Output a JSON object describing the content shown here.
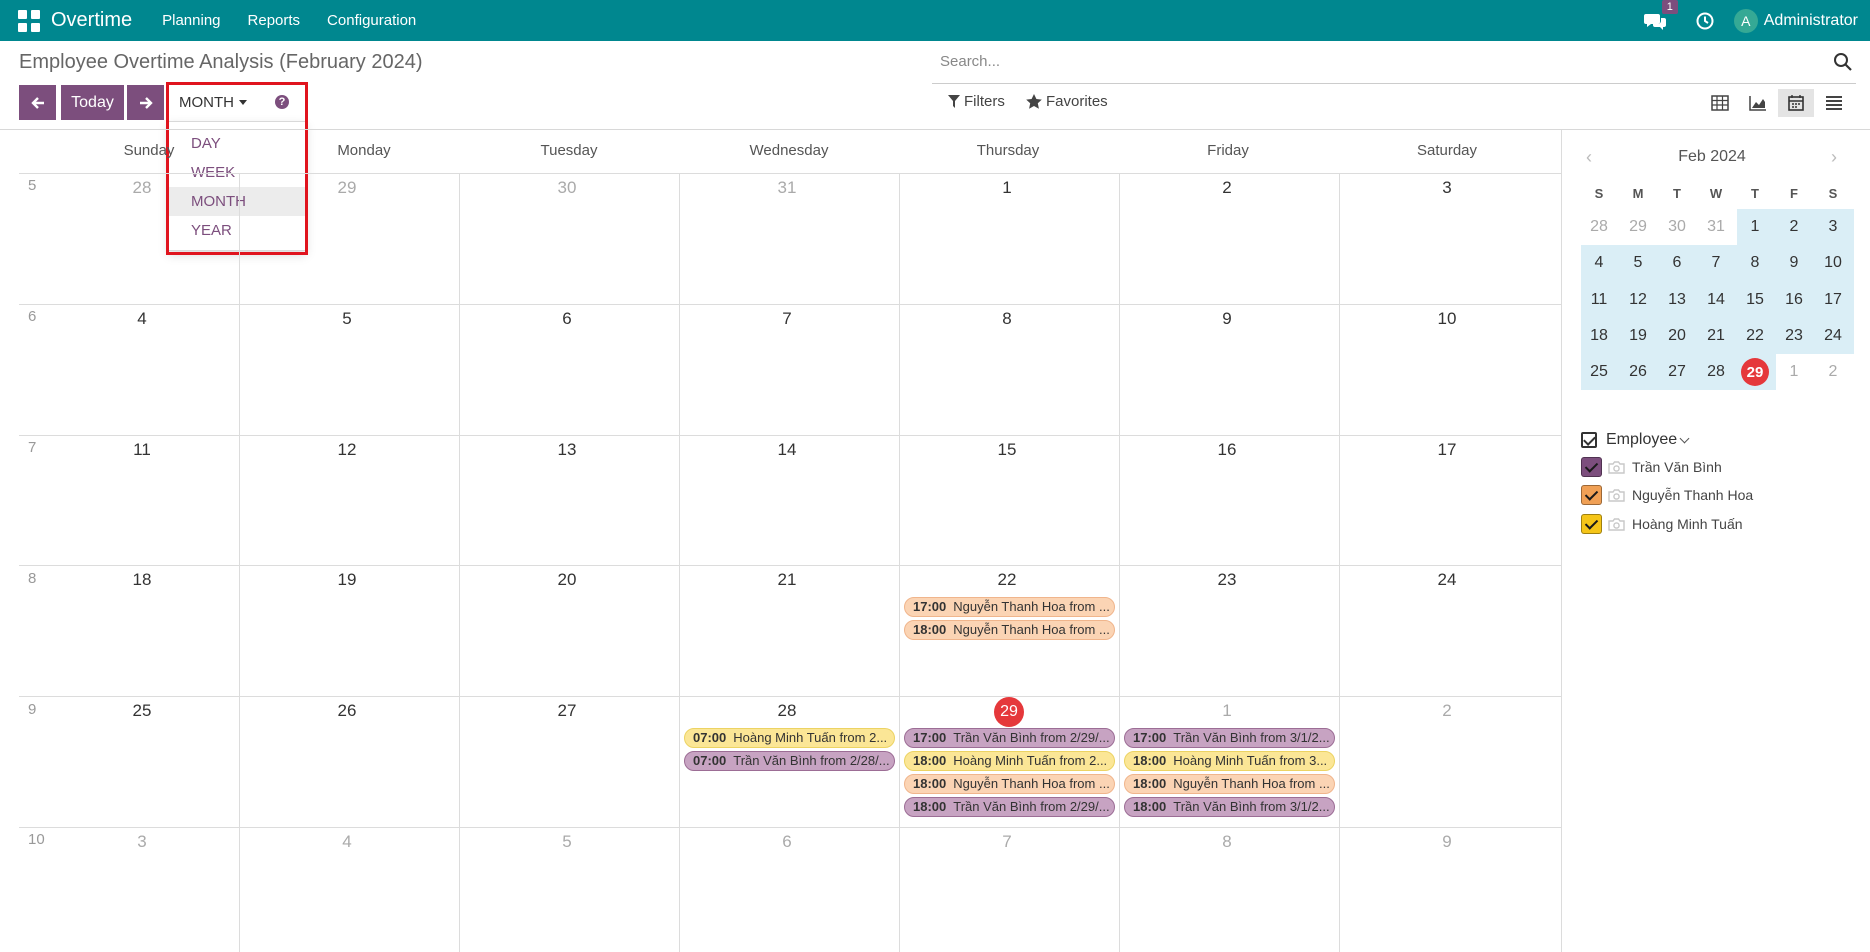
{
  "navbar": {
    "brand": "Overtime",
    "menus": [
      "Planning",
      "Reports",
      "Configuration"
    ],
    "chat_badge": "1",
    "avatar_letter": "A",
    "user": "Administrator"
  },
  "control": {
    "title": "Employee Overtime Analysis (February 2024)",
    "search_placeholder": "Search...",
    "today_label": "Today",
    "scale_label": "MONTH",
    "help": "?",
    "scale_options": [
      "DAY",
      "WEEK",
      "MONTH",
      "YEAR"
    ],
    "active_scale": "MONTH",
    "filters_label": "Filters",
    "favorites_label": "Favorites"
  },
  "calendar": {
    "weekdays": [
      "Sunday",
      "Monday",
      "Tuesday",
      "Wednesday",
      "Thursday",
      "Friday",
      "Saturday"
    ],
    "weeks": [
      {
        "num": "5",
        "days": [
          "28",
          "29",
          "30",
          "31",
          "1",
          "2",
          "3"
        ]
      },
      {
        "num": "6",
        "days": [
          "4",
          "5",
          "6",
          "7",
          "8",
          "9",
          "10"
        ]
      },
      {
        "num": "7",
        "days": [
          "11",
          "12",
          "13",
          "14",
          "15",
          "16",
          "17"
        ]
      },
      {
        "num": "8",
        "days": [
          "18",
          "19",
          "20",
          "21",
          "22",
          "23",
          "24"
        ]
      },
      {
        "num": "9",
        "days": [
          "25",
          "26",
          "27",
          "28",
          "29",
          "1",
          "2"
        ]
      },
      {
        "num": "10",
        "days": [
          "3",
          "4",
          "5",
          "6",
          "7",
          "8",
          "9"
        ]
      }
    ],
    "events": {
      "thu22": [
        {
          "time": "17:00",
          "text": "Nguyễn Thanh Hoa from ..."
        },
        {
          "time": "18:00",
          "text": "Nguyễn Thanh Hoa from ..."
        }
      ],
      "wed28": [
        {
          "time": "07:00",
          "text": "Hoàng Minh Tuấn from 2..."
        },
        {
          "time": "07:00",
          "text": "Trần Văn Bình from 2/28/..."
        }
      ],
      "thu29": [
        {
          "time": "17:00",
          "text": "Trần Văn Bình from 2/29/..."
        },
        {
          "time": "18:00",
          "text": "Hoàng Minh Tuấn from 2..."
        },
        {
          "time": "18:00",
          "text": "Nguyễn Thanh Hoa from ..."
        },
        {
          "time": "18:00",
          "text": "Trần Văn Bình from 2/29/..."
        }
      ],
      "fri1": [
        {
          "time": "17:00",
          "text": "Trần Văn Bình from 3/1/2..."
        },
        {
          "time": "18:00",
          "text": "Hoàng Minh Tuấn from 3..."
        },
        {
          "time": "18:00",
          "text": "Nguyễn Thanh Hoa from ..."
        },
        {
          "time": "18:00",
          "text": "Trần Văn Bình from 3/1/2..."
        }
      ]
    },
    "colors": {
      "binh": "#c7a3c2",
      "hoa": "#fbd4b4",
      "tuan": "#fbe696",
      "today": "#e5383b",
      "accent": "#7c4e7d",
      "navbar": "#00878f"
    }
  },
  "sidebar": {
    "month_title": "Feb 2024",
    "prev": "‹",
    "next": "›",
    "dow": [
      "S",
      "M",
      "T",
      "W",
      "T",
      "F",
      "S"
    ],
    "weeks": [
      [
        "28",
        "29",
        "30",
        "31",
        "1",
        "2",
        "3"
      ],
      [
        "4",
        "5",
        "6",
        "7",
        "8",
        "9",
        "10"
      ],
      [
        "11",
        "12",
        "13",
        "14",
        "15",
        "16",
        "17"
      ],
      [
        "18",
        "19",
        "20",
        "21",
        "22",
        "23",
        "24"
      ],
      [
        "25",
        "26",
        "27",
        "28",
        "29",
        "1",
        "2"
      ]
    ],
    "filter_title": "Employee",
    "employees": [
      {
        "name": "Trần Văn Bình",
        "color": "#7c4e7d"
      },
      {
        "name": "Nguyễn Thanh Hoa",
        "color": "#f0a055"
      },
      {
        "name": "Hoàng Minh Tuấn",
        "color": "#f5c518"
      }
    ]
  }
}
